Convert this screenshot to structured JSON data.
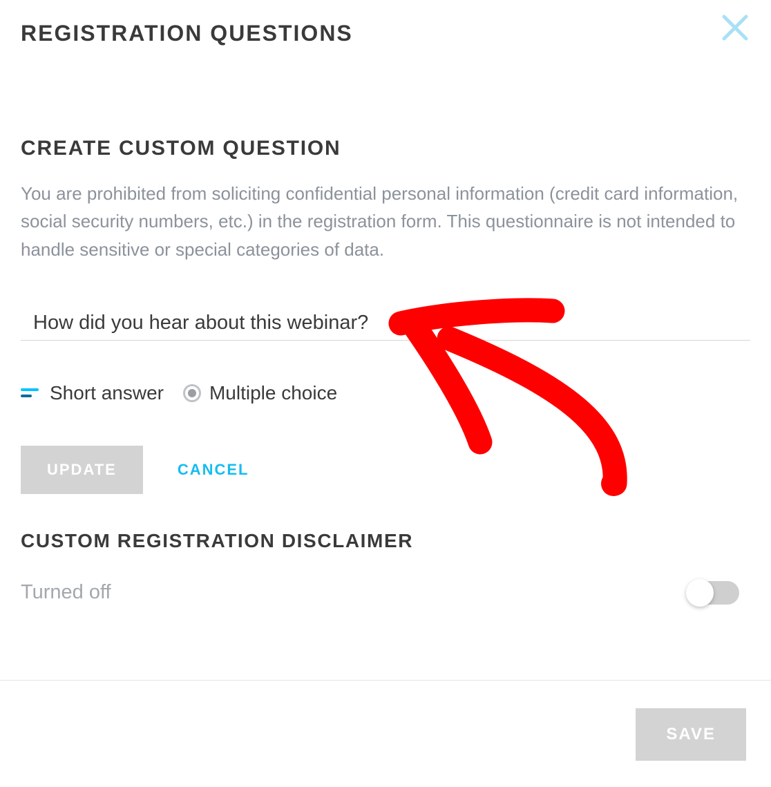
{
  "header": {
    "title": "Registration Questions"
  },
  "create": {
    "heading": "Create Custom Question",
    "description": "You are prohibited from soliciting confidential personal information (credit card information, social security numbers, etc.) in the registration form. This questionnaire is not intended to handle sensitive or special categories of data.",
    "question_value": "How did you hear about this webinar?",
    "types": {
      "short": "Short answer",
      "multiple": "Multiple choice",
      "selected": "short"
    },
    "update_label": "UPDATE",
    "cancel_label": "CANCEL"
  },
  "disclaimer": {
    "heading": "Custom Registration Disclaimer",
    "status_label": "Turned off",
    "enabled": false
  },
  "footer": {
    "save_label": "SAVE"
  },
  "annotation": {
    "color": "#ff0000",
    "description": "hand-drawn-arrow"
  }
}
